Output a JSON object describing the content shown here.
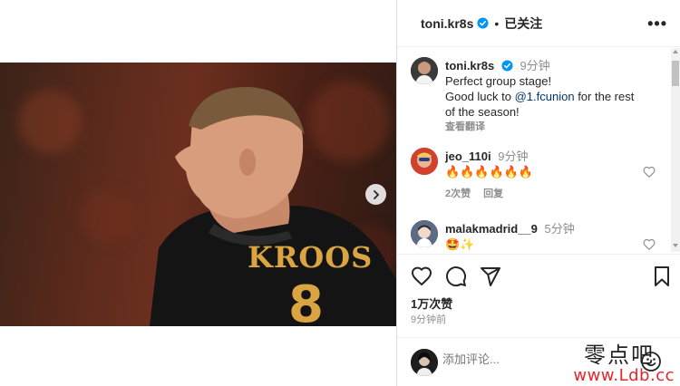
{
  "post": {
    "username": "toni.kr8s",
    "follow_status": "已关注",
    "separator": "•",
    "more_label": "•••",
    "carousel": {
      "slide_count": 2,
      "active_slide": 1
    },
    "jersey_text": "KROOS",
    "jersey_number": "8"
  },
  "caption": {
    "username": "toni.kr8s",
    "time": "9分钟",
    "line1": "Perfect group stage!",
    "line2_prefix": "Good luck to ",
    "mention": "@1.fcunion",
    "line2_suffix": " for the rest",
    "line3": "of the season!",
    "see_translation": "查看翻译"
  },
  "comments": [
    {
      "username": "jeo_110i",
      "time": "9分钟",
      "text": "🔥🔥🔥🔥🔥🔥",
      "likes": "2次赞",
      "reply": "回复"
    },
    {
      "username": "malakmadrid__9",
      "time": "5分钟",
      "text": "🤩✨"
    }
  ],
  "actions": {
    "likes": "1万次赞",
    "post_time": "9分钟前"
  },
  "comment_box": {
    "placeholder": "添加评论..."
  },
  "watermark": {
    "top": "零点吧",
    "bottom": "www.Ldb.cc"
  },
  "colors": {
    "verified_blue": "#0095f6",
    "mention": "#00376b",
    "jersey_gold": "#d9a441",
    "watermark_red": "#e3262c"
  }
}
